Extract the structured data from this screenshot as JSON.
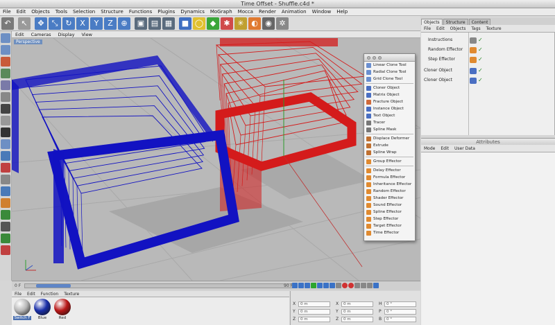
{
  "window": {
    "title": "Time Offset - Shuffle.c4d *"
  },
  "menubar": [
    "File",
    "Edit",
    "Objects",
    "Tools",
    "Selection",
    "Structure",
    "Functions",
    "Plugins",
    "Dynamics",
    "MoGraph",
    "Mocca",
    "Render",
    "Animation",
    "Window",
    "Help"
  ],
  "toolbar": {
    "icons": [
      {
        "name": "undo-icon",
        "color": "#7a7a7a",
        "glyph": "↶"
      },
      {
        "name": "select-arrow-icon",
        "color": "#9a9a9a",
        "glyph": "↖"
      },
      {
        "name": "move-icon",
        "color": "#4a7cc4",
        "glyph": "✥"
      },
      {
        "name": "scale-icon",
        "color": "#4a7cc4",
        "glyph": "⤡"
      },
      {
        "name": "rotate-icon",
        "color": "#4a7cc4",
        "glyph": "↻"
      },
      {
        "name": "x-axis-icon",
        "color": "#4a7cc4",
        "glyph": "X"
      },
      {
        "name": "y-axis-icon",
        "color": "#4a7cc4",
        "glyph": "Y"
      },
      {
        "name": "z-axis-icon",
        "color": "#4a7cc4",
        "glyph": "Z"
      },
      {
        "name": "world-coordinates-icon",
        "color": "#4a7cc4",
        "glyph": "⊕"
      },
      {
        "name": "render-view-icon",
        "color": "#5a6b7d",
        "glyph": "▣"
      },
      {
        "name": "render-picture-viewer-icon",
        "color": "#5a6b7d",
        "glyph": "▤"
      },
      {
        "name": "render-settings-icon",
        "color": "#5a6b7d",
        "glyph": "▦"
      },
      {
        "name": "cube-primitive-icon",
        "color": "#3f6fc2",
        "glyph": "■"
      },
      {
        "name": "spline-icon",
        "color": "#e0c030",
        "glyph": "◯"
      },
      {
        "name": "nurbs-icon",
        "color": "#3aa63a",
        "glyph": "◆"
      },
      {
        "name": "array-icon",
        "color": "#d04a4a",
        "glyph": "✱"
      },
      {
        "name": "deformer-icon",
        "color": "#c0a030",
        "glyph": "✳"
      },
      {
        "name": "scene-icon",
        "color": "#e07a30",
        "glyph": "◐"
      },
      {
        "name": "camera-icon",
        "color": "#666666",
        "glyph": "◉"
      },
      {
        "name": "light-icon",
        "color": "#888888",
        "glyph": "✲"
      }
    ]
  },
  "viewport": {
    "menu": [
      "Edit",
      "Cameras",
      "Display",
      "View"
    ],
    "label": "Perspective"
  },
  "clone_menu": {
    "items": [
      {
        "label": "Linear Clone Tool",
        "icon": "linear-clone-tool-icon",
        "color": "#6a8fd0"
      },
      {
        "label": "Radial Clone Tool",
        "icon": "radial-clone-tool-icon",
        "color": "#6a8fd0"
      },
      {
        "label": "Grid Clone Tool",
        "icon": "grid-clone-tool-icon",
        "color": "#6a8fd0"
      },
      {
        "sep": true
      },
      {
        "label": "Cloner Object",
        "icon": "cloner-object-icon",
        "color": "#4a6fc2"
      },
      {
        "label": "Matrix Object",
        "icon": "matrix-object-icon",
        "color": "#4a6fc2"
      },
      {
        "label": "Fracture Object",
        "icon": "fracture-object-icon",
        "color": "#d06a3a"
      },
      {
        "label": "Instance Object",
        "icon": "instance-object-icon",
        "color": "#4a6fc2"
      },
      {
        "label": "Text Object",
        "icon": "text-object-icon",
        "color": "#4a6fc2"
      },
      {
        "label": "Tracer",
        "icon": "tracer-icon",
        "color": "#777777"
      },
      {
        "label": "Spline Mask",
        "icon": "spline-mask-icon",
        "color": "#777777"
      },
      {
        "sep": true
      },
      {
        "label": "Displace Deformer",
        "icon": "displace-deformer-icon",
        "color": "#c07030"
      },
      {
        "label": "Extrude",
        "icon": "extrude-icon",
        "color": "#c07030"
      },
      {
        "label": "Spline Wrap",
        "icon": "spline-wrap-icon",
        "color": "#c07030"
      },
      {
        "sep": true
      },
      {
        "label": "Group Effector",
        "icon": "group-effector-icon",
        "color": "#e08a30"
      },
      {
        "sep": true
      },
      {
        "label": "Delay Effector",
        "icon": "delay-effector-icon",
        "color": "#e08a30"
      },
      {
        "label": "Formula Effector",
        "icon": "formula-effector-icon",
        "color": "#e08a30"
      },
      {
        "label": "Inheritance Effector",
        "icon": "inheritance-effector-icon",
        "color": "#e08a30"
      },
      {
        "label": "Random Effector",
        "icon": "random-effector-icon",
        "color": "#e08a30"
      },
      {
        "label": "Shader Effector",
        "icon": "shader-effector-icon",
        "color": "#e08a30"
      },
      {
        "label": "Sound Effector",
        "icon": "sound-effector-icon",
        "color": "#e08a30"
      },
      {
        "label": "Spline Effector",
        "icon": "spline-effector-icon",
        "color": "#e08a30"
      },
      {
        "label": "Step Effector",
        "icon": "step-effector-icon",
        "color": "#e08a30"
      },
      {
        "label": "Target Effector",
        "icon": "target-effector-icon",
        "color": "#e08a30"
      },
      {
        "label": "Time Effector",
        "icon": "time-effector-icon",
        "color": "#e08a30"
      }
    ]
  },
  "object_manager": {
    "tabs": [
      "Objects",
      "Structure",
      "Content"
    ],
    "active_tab": "Objects",
    "menu": [
      "File",
      "Edit",
      "Objects",
      "Tags",
      "Texture"
    ],
    "rows": [
      {
        "label": "Instructions",
        "icon": "null-object-icon",
        "color": "#888888"
      },
      {
        "label": "Random Effector",
        "icon": "random-effector-icon",
        "color": "#e08a30"
      },
      {
        "label": "Step Effector",
        "icon": "step-effector-icon",
        "color": "#e08a30"
      },
      {
        "label": "Cloner Object",
        "icon": "cloner-object-icon",
        "color": "#4a6fc2"
      },
      {
        "label": "Cloner Object",
        "icon": "cloner-object-icon",
        "color": "#4a6fc2"
      }
    ]
  },
  "attributes": {
    "title": "Attributes",
    "menu": [
      "Mode",
      "Edit",
      "User Data"
    ]
  },
  "timeline": {
    "start": "0 F",
    "end": "90 F",
    "progress_fraction": 0.04
  },
  "material_manager": {
    "menu": [
      "File",
      "Edit",
      "Function",
      "Texture"
    ],
    "materials": [
      {
        "name": "Switch F",
        "color": "#b8b8b8",
        "selected": true
      },
      {
        "name": "Blue",
        "color": "#1a2fa8",
        "selected": false
      },
      {
        "name": "Red",
        "color": "#b81818",
        "selected": false
      }
    ]
  },
  "coordinates": {
    "rows": [
      {
        "a_label": "X",
        "a_val": "0 m",
        "b_label": "X",
        "b_val": "0 m",
        "c_label": "H",
        "c_val": "0 °"
      },
      {
        "a_label": "Y",
        "a_val": "0 m",
        "b_label": "Y",
        "b_val": "0 m",
        "c_label": "P",
        "c_val": "0 °"
      },
      {
        "a_label": "Z",
        "a_val": "0 m",
        "b_label": "Z",
        "b_val": "0 m",
        "c_label": "B",
        "c_val": "0 °"
      }
    ]
  }
}
